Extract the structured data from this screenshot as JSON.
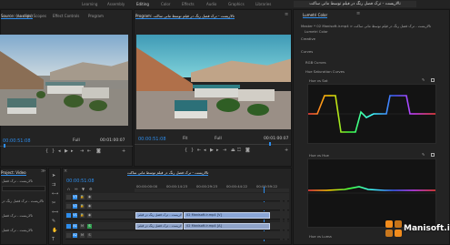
{
  "workspaces": [
    "Learning",
    "Assembly",
    "Editing",
    "Color",
    "Effects",
    "Audio",
    "Graphics",
    "Libraries"
  ],
  "window_title": "تالاریست - ترک فضل رنگ در فیلم توسط مانی ساکت",
  "source_panel": {
    "tabs": [
      "Source: (no clips)",
      "Lumetri Scopes",
      "Effect Controls",
      "Program"
    ],
    "timecode": "00:00:51:08",
    "zoom": "Full",
    "duration": "00:01:00:07"
  },
  "program_panel": {
    "title": "Program: تالاریست - ترک فضل رنگ در فیلم توسط مانی ساکت",
    "timecode": "00:00:51:08",
    "fit": "Fit",
    "quality": "Full",
    "duration": "00:01:00:07"
  },
  "lumetri": {
    "tab": "Lumetri Color",
    "master_line": "Master * 02 Manisoft.ir.mp4 > تالاریست - ترک فضل رنگ در فیلم توسط مانی ساکت",
    "fx_label": "Lumetri Color",
    "sections": [
      "Creative",
      "Curves",
      "RGB Curves",
      "Hue Saturation Curves"
    ],
    "graphs": [
      {
        "label": "Hue vs Sat"
      },
      {
        "label": "Hue vs Hue"
      },
      {
        "label": "Hue vs Luma"
      }
    ]
  },
  "project_panel": {
    "tab": "Project: Video",
    "file_name": "تالاریست - ترک فضل",
    "items": [
      "تالاریست - ترک فضل رنگ در",
      "تالاریست - ترک فضل",
      "تالاریست - ترک فضل"
    ]
  },
  "timeline": {
    "sequence_title": "تالاریست - ترک فضل رنگ در فیلم توسط مانی ساکت",
    "timecode": "00:00:51:08",
    "ruler": [
      "00:00:00:00",
      "00:00:14:23",
      "00:00:29:23",
      "00:00:44:22",
      "00:00:59:22"
    ],
    "tracks": [
      "V3",
      "V2",
      "V1",
      "A1",
      "A2",
      "A3"
    ],
    "clips": [
      {
        "name": "تالاریست - ترک فضل رنگ در فیلم",
        "track": "V1"
      },
      {
        "name": "02 Manisoft.ir.mp4 [V]",
        "track": "V1b"
      },
      {
        "name": "تالاریست - ترک فضل رنگ در فیلم",
        "track": "A1"
      },
      {
        "name": "02 Manisoft.ir.mp4 [A]",
        "track": "A1b"
      }
    ]
  },
  "watermark": {
    "text": "Manisoft.ir",
    "accent": "#f28c1c"
  },
  "colors": {
    "accent": "#2d8ceb",
    "timecode_blue": "#2d8ceb",
    "panel": "#232323"
  }
}
